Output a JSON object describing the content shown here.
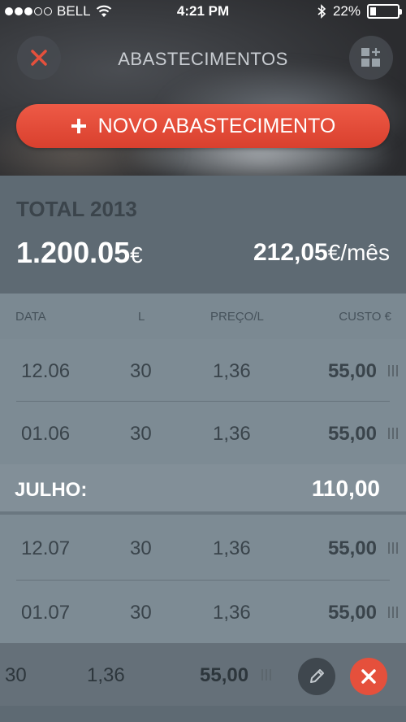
{
  "status_bar": {
    "carrier": "BELL",
    "time": "4:21 PM",
    "battery": "22%",
    "battery_level": 0.22
  },
  "header": {
    "title": "ABASTECIMENTOS",
    "new_button_label": "NOVO ABASTECIMENTO"
  },
  "totals": {
    "label": "TOTAL 2013",
    "amount": "1.200.05",
    "amount_currency": "€",
    "monthly": "212,05",
    "monthly_suffix": "€/mês"
  },
  "columns": [
    "DATA",
    "L",
    "PREÇO/L",
    "CUSTO €"
  ],
  "rows": [
    {
      "date": "12.06",
      "liters": "30",
      "price": "1,36",
      "cost": "55,00"
    },
    {
      "date": "01.06",
      "liters": "30",
      "price": "1,36",
      "cost": "55,00"
    },
    {
      "date": "12.07",
      "liters": "30",
      "price": "1,36",
      "cost": "55,00"
    },
    {
      "date": "01.07",
      "liters": "30",
      "price": "1,36",
      "cost": "55,00"
    }
  ],
  "month_summary": {
    "label": "JULHO:",
    "value": "110,00"
  },
  "swiped_row": {
    "liters": "30",
    "price": "1,36",
    "cost": "55,00"
  },
  "colors": {
    "accent_red": "#e5503c",
    "panel": "#5e6a73",
    "row": "#7d8b94"
  }
}
